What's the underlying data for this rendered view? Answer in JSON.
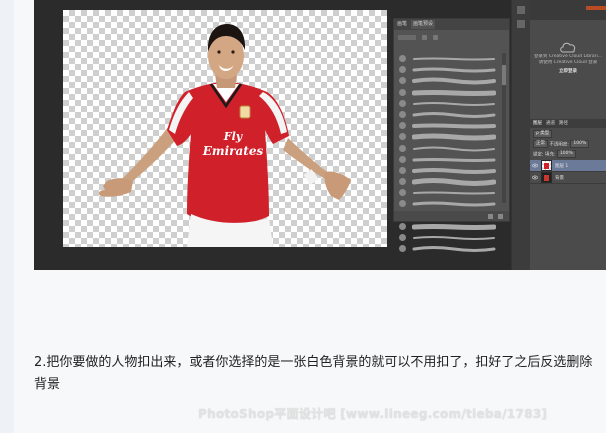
{
  "brush_panel": {
    "tabs": [
      "画笔",
      "画笔预设"
    ],
    "brush_count": 18
  },
  "creative_cloud": {
    "line1": "登录到 Creative Cloud Librari...",
    "line2": "请使用 Creative Cloud 登录",
    "link": "立即登录"
  },
  "layers_panel": {
    "tabs": [
      "图层",
      "通道",
      "路径"
    ],
    "kind": "ρ 类型",
    "blend": "正常",
    "opacity_label": "不透明度:",
    "opacity_value": "100%",
    "lock_label": "锁定:",
    "fill_label": "填充:",
    "fill_value": "100%",
    "layers": [
      {
        "name": "图层 1",
        "selected": true
      },
      {
        "name": "背景",
        "selected": false
      }
    ]
  },
  "caption": "2.把你要做的人物扣出来，或者你选择的是一张白色背景的就可以不用扣了，扣好了之后反选删除背景",
  "watermark": "PhotoShop平面设计吧 [www.lineeg.com/tieba/1783]",
  "colors": {
    "canvas_bg": "#2b2b2b",
    "panel": "#535353",
    "layer_selected": "#6b7a99",
    "jersey_red": "#d0202a"
  }
}
